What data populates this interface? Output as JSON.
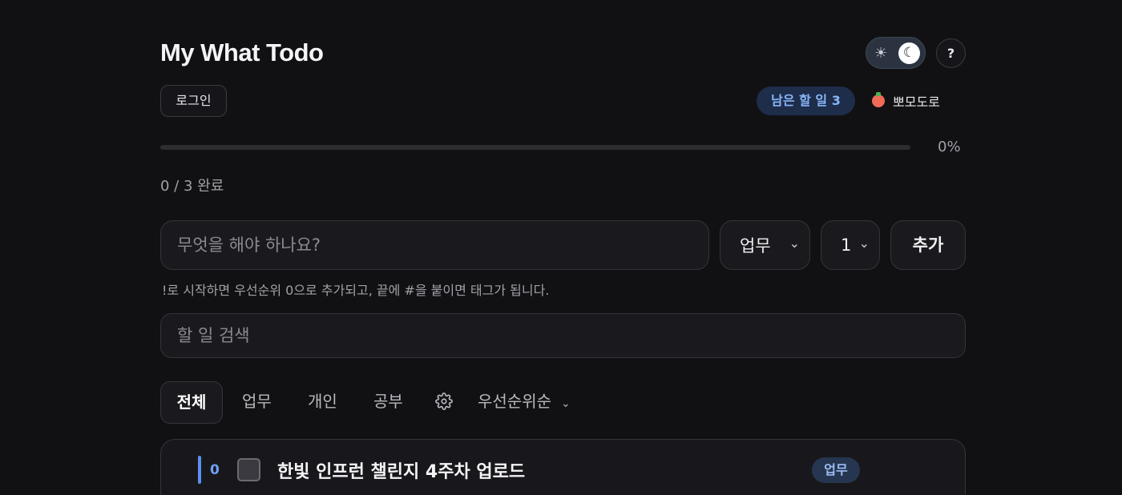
{
  "app": {
    "title": "My What Todo"
  },
  "header": {
    "theme_toggle": {
      "light_icon": "sun-icon",
      "dark_icon": "moon-icon",
      "sun_glyph": "☀",
      "moon_glyph": "☾",
      "mode": "dark"
    },
    "help_label": "?",
    "login_label": "로그인",
    "remaining_label": "남은 할 일 3",
    "pomodoro_label": "뽀모도로"
  },
  "progress": {
    "percent_label": "0%",
    "fraction": 0,
    "count_label": "0 / 3 완료"
  },
  "composer": {
    "placeholder": "무엇을 해야 하나요?",
    "category_value": "업무",
    "priority_value": "1",
    "add_label": "추가",
    "hint": "!로 시작하면 우선순위 0으로 추가되고, 끝에 #을 붙이면 태그가 됩니다."
  },
  "search": {
    "placeholder": "할 일 검색"
  },
  "filters": {
    "tabs": [
      {
        "label": "전체",
        "active": true
      },
      {
        "label": "업무",
        "active": false
      },
      {
        "label": "개인",
        "active": false
      },
      {
        "label": "공부",
        "active": false
      }
    ],
    "sort_label": "우선순위순"
  },
  "todos": [
    {
      "priority": "0",
      "text": "한빛 인프런 챌린지 4주차 업로드",
      "tag": "업무",
      "done": false
    }
  ],
  "colors": {
    "background": "#111113",
    "accent": "#6fa0f5",
    "badge_bg": "#1d2d4a",
    "tomato": "#ef6b57"
  }
}
